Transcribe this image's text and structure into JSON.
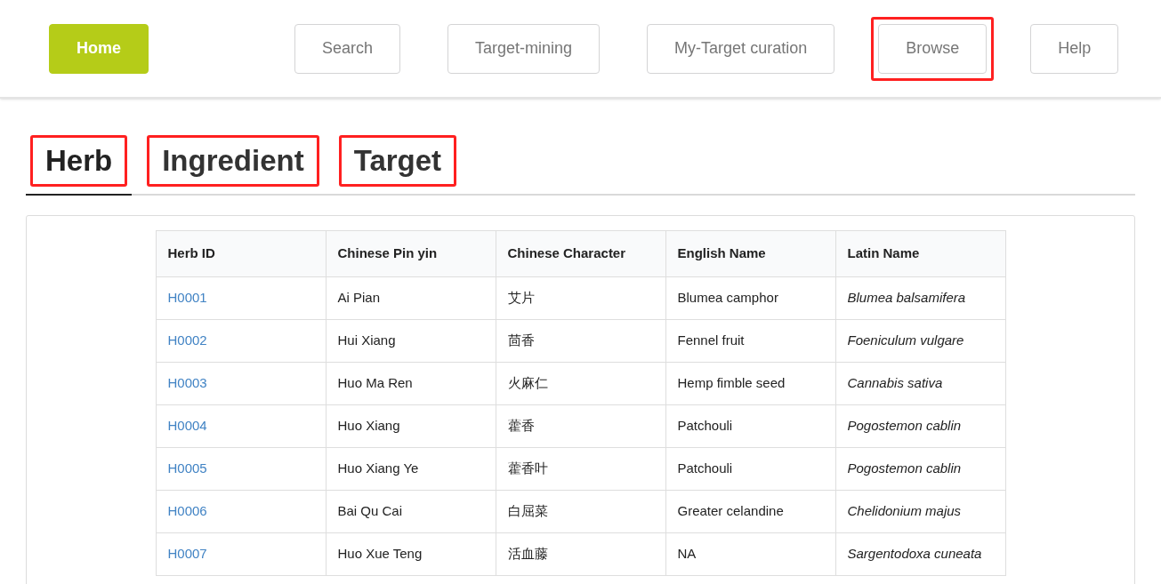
{
  "nav": [
    {
      "label": "Home",
      "kind": "primary",
      "highlighted": false
    },
    {
      "label": "Search",
      "kind": "plain",
      "highlighted": false
    },
    {
      "label": "Target-mining",
      "kind": "plain",
      "highlighted": false
    },
    {
      "label": "My-Target curation",
      "kind": "plain",
      "highlighted": false
    },
    {
      "label": "Browse",
      "kind": "plain",
      "highlighted": true
    },
    {
      "label": "Help",
      "kind": "plain",
      "highlighted": false
    }
  ],
  "tabs": [
    {
      "label": "Herb",
      "selected": true,
      "highlighted": true
    },
    {
      "label": "Ingredient",
      "selected": false,
      "highlighted": true
    },
    {
      "label": "Target",
      "selected": false,
      "highlighted": true
    }
  ],
  "table": {
    "columns": [
      {
        "label": "Herb ID",
        "kind": "link"
      },
      {
        "label": "Chinese Pin yin",
        "kind": "text"
      },
      {
        "label": "Chinese Character",
        "kind": "text"
      },
      {
        "label": "English Name",
        "kind": "text"
      },
      {
        "label": "Latin Name",
        "kind": "italic"
      }
    ],
    "rows": [
      [
        "H0001",
        "Ai Pian",
        "艾片",
        "Blumea camphor",
        "Blumea balsamifera"
      ],
      [
        "H0002",
        "Hui Xiang",
        "茴香",
        "Fennel fruit",
        "Foeniculum vulgare"
      ],
      [
        "H0003",
        "Huo Ma Ren",
        "火麻仁",
        "Hemp fimble seed",
        "Cannabis sativa"
      ],
      [
        "H0004",
        "Huo Xiang",
        "藿香",
        "Patchouli",
        "Pogostemon cablin"
      ],
      [
        "H0005",
        "Huo Xiang Ye",
        "藿香叶",
        "Patchouli",
        "Pogostemon cablin"
      ],
      [
        "H0006",
        "Bai Qu Cai",
        "白屈菜",
        "Greater celandine",
        "Chelidonium majus"
      ],
      [
        "H0007",
        "Huo Xue Teng",
        "活血藤",
        "NA",
        "Sargentodoxa cuneata"
      ]
    ]
  }
}
